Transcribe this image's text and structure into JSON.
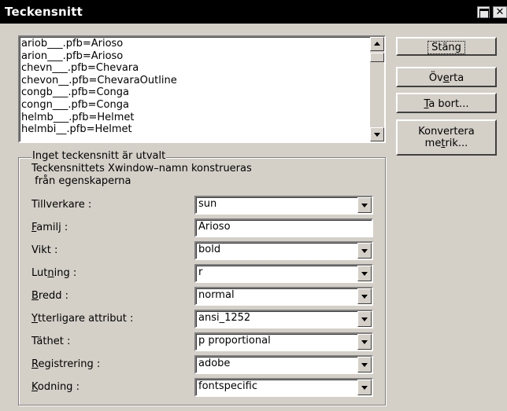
{
  "window": {
    "title": "Teckensnitt"
  },
  "font_list": {
    "items": [
      "ariob___.pfb=Arioso",
      "arion___.pfb=Arioso",
      "chevn___.pfb=Chevara",
      "chevon__.pfb=ChevaraOutline",
      "congb___.pfb=Conga",
      "congn___.pfb=Conga",
      "helmb___.pfb=Helmet",
      "helmbi__.pfb=Helmet"
    ]
  },
  "buttons": {
    "close": "Stäng",
    "overwrite_pre": "Öv",
    "overwrite_u": "e",
    "overwrite_post": "rta",
    "remove_u": "T",
    "remove_post": "a bort...",
    "convert_line1": "Konvertera",
    "convert_line2_pre": "me",
    "convert_line2_u": "t",
    "convert_line2_post": "rik..."
  },
  "group": {
    "legend": "Inget teckensnitt är utvalt",
    "info_line1": "Teckensnittets Xwindow–namn konstrueras",
    "info_line2": " från egenskaperna"
  },
  "properties": [
    {
      "label": "Tillverkare :",
      "value": "sun",
      "type": "dropdown"
    },
    {
      "label_u": "F",
      "label_post": "amilj :",
      "value": "Arioso",
      "type": "text"
    },
    {
      "label": "Vikt :",
      "value": "bold",
      "type": "dropdown"
    },
    {
      "label_pre": "Lut",
      "label_u": "n",
      "label_post": "ing :",
      "value": "r",
      "type": "dropdown"
    },
    {
      "label_u": "B",
      "label_post": "redd :",
      "value": "normal",
      "type": "dropdown"
    },
    {
      "label_u": "Y",
      "label_post": "tterligare attribut :",
      "value": "ansi_1252",
      "type": "dropdown"
    },
    {
      "label": "Täthet :",
      "value": "p proportional",
      "type": "dropdown"
    },
    {
      "label_u": "R",
      "label_post": "egistrering :",
      "value": "adobe",
      "type": "dropdown"
    },
    {
      "label_u": "K",
      "label_post": "odning :",
      "value": "fontspecific",
      "type": "dropdown"
    }
  ]
}
